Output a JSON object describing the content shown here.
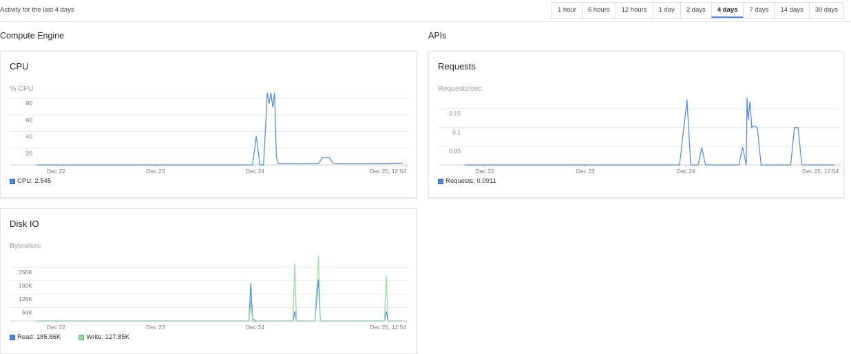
{
  "header": {
    "activity_label": "Activity for the last 4 days",
    "time_ranges": [
      "1 hour",
      "6 hours",
      "12 hours",
      "1 day",
      "2 days",
      "4 days",
      "7 days",
      "14 days",
      "30 days"
    ],
    "selected_range": "4 days"
  },
  "sections": {
    "compute": "Compute Engine",
    "apis": "APIs"
  },
  "colors": {
    "blue": "#4a86e8",
    "green": "#93d9a0",
    "grid": "#e8e8e8"
  },
  "cards": {
    "cpu": {
      "title": "CPU",
      "unit": "% CPU",
      "legend": [
        {
          "label": "CPU: 2.545",
          "color": "#4a86e8"
        }
      ]
    },
    "requests": {
      "title": "Requests",
      "unit": "Requests/sec",
      "legend": [
        {
          "label": "Requests: 0.0911",
          "color": "#4a86e8"
        }
      ]
    },
    "disk": {
      "title": "Disk IO",
      "unit": "Bytes/sec",
      "legend": [
        {
          "label": "Read: 185.86K",
          "color": "#4a86e8"
        },
        {
          "label": "Write: 127.85K",
          "color": "#93d9a0"
        }
      ]
    }
  },
  "chart_data": [
    {
      "id": "cpu",
      "type": "line",
      "x_ticks": [
        "Dec 22",
        "Dec 23",
        "Dec 24",
        "Dec 25, 12:54"
      ],
      "y_ticks": [
        "20",
        "40",
        "60",
        "80"
      ],
      "ylim": [
        0,
        100
      ],
      "x": [
        0,
        0.59,
        0.6,
        0.61,
        0.62,
        0.63,
        0.635,
        0.64,
        0.645,
        0.65,
        0.655,
        0.66,
        0.67,
        0.7,
        0.77,
        0.78,
        0.79,
        0.8,
        0.81,
        0.85,
        0.9,
        1.0
      ],
      "series": [
        {
          "name": "CPU",
          "color": "#4a86e8",
          "values": [
            0,
            0,
            40,
            0,
            0,
            100,
            85,
            100,
            80,
            100,
            10,
            2,
            2,
            2,
            2,
            10,
            10,
            10,
            2,
            2,
            2,
            2.5
          ]
        }
      ]
    },
    {
      "id": "requests",
      "type": "line",
      "x_ticks": [
        "Dec 22",
        "Dec 23",
        "Dec 24",
        "Dec 25, 12:54"
      ],
      "y_ticks": [
        "0.05",
        "0.1",
        "0.15"
      ],
      "ylim": [
        0,
        0.19
      ],
      "x": [
        0,
        0.58,
        0.6,
        0.61,
        0.63,
        0.64,
        0.65,
        0.74,
        0.75,
        0.76,
        0.762,
        0.765,
        0.77,
        0.775,
        0.78,
        0.79,
        0.8,
        0.82,
        0.88,
        0.89,
        0.9,
        0.91,
        1.0
      ],
      "series": [
        {
          "name": "Requests",
          "color": "#4a86e8",
          "values": [
            0,
            0,
            0.175,
            0,
            0,
            0.047,
            0,
            0,
            0.048,
            0,
            0.18,
            0.12,
            0.17,
            0.1,
            0.105,
            0.1,
            0,
            0,
            0,
            0.1,
            0.1,
            0,
            0
          ]
        }
      ]
    },
    {
      "id": "disk",
      "type": "line",
      "x_ticks": [
        "Dec 22",
        "Dec 23",
        "Dec 24",
        "Dec 25, 12:54"
      ],
      "y_ticks": [
        "64K",
        "128K",
        "192K",
        "256K"
      ],
      "ylim": [
        0,
        340
      ],
      "x": [
        0,
        0.58,
        0.585,
        0.59,
        0.6,
        0.7,
        0.705,
        0.71,
        0.76,
        0.77,
        0.775,
        0.78,
        0.95,
        0.955,
        0.96,
        1.0
      ],
      "series": [
        {
          "name": "Read",
          "color": "#4a86e8",
          "values": [
            0,
            0,
            190,
            10,
            0,
            0,
            50,
            0,
            0,
            210,
            0,
            0,
            0,
            50,
            0,
            0
          ]
        },
        {
          "name": "Write",
          "color": "#93d9a0",
          "values": [
            0,
            0,
            100,
            0,
            0,
            0,
            290,
            0,
            0,
            330,
            0,
            0,
            0,
            230,
            0,
            0
          ]
        }
      ]
    }
  ]
}
